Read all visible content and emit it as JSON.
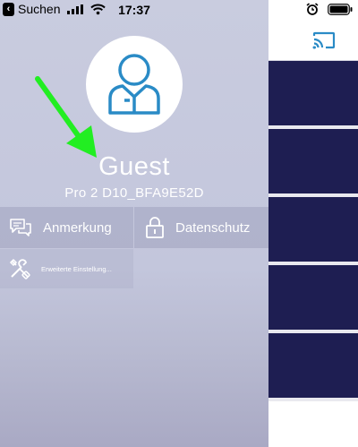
{
  "status_bar": {
    "back_app": "Suchen",
    "time": "17:37"
  },
  "drawer": {
    "username": "Guest",
    "device_name": "Pro 2 D10_BFA9E52D",
    "menu": [
      {
        "label": "Anmerkung",
        "icon": "chat-bubbles-icon"
      },
      {
        "label": "Datenschutz",
        "icon": "lock-icon"
      }
    ],
    "settings_label": "Erweiterte Einstellung..."
  },
  "main_panel": {
    "cast_icon": "cast-icon",
    "tile_count": 5
  },
  "colors": {
    "drawer_background": "#c9ccdf",
    "accent_blue": "#2a8bc6",
    "tile_navy": "#1e1e52",
    "annotation_arrow": "#22ee22"
  }
}
